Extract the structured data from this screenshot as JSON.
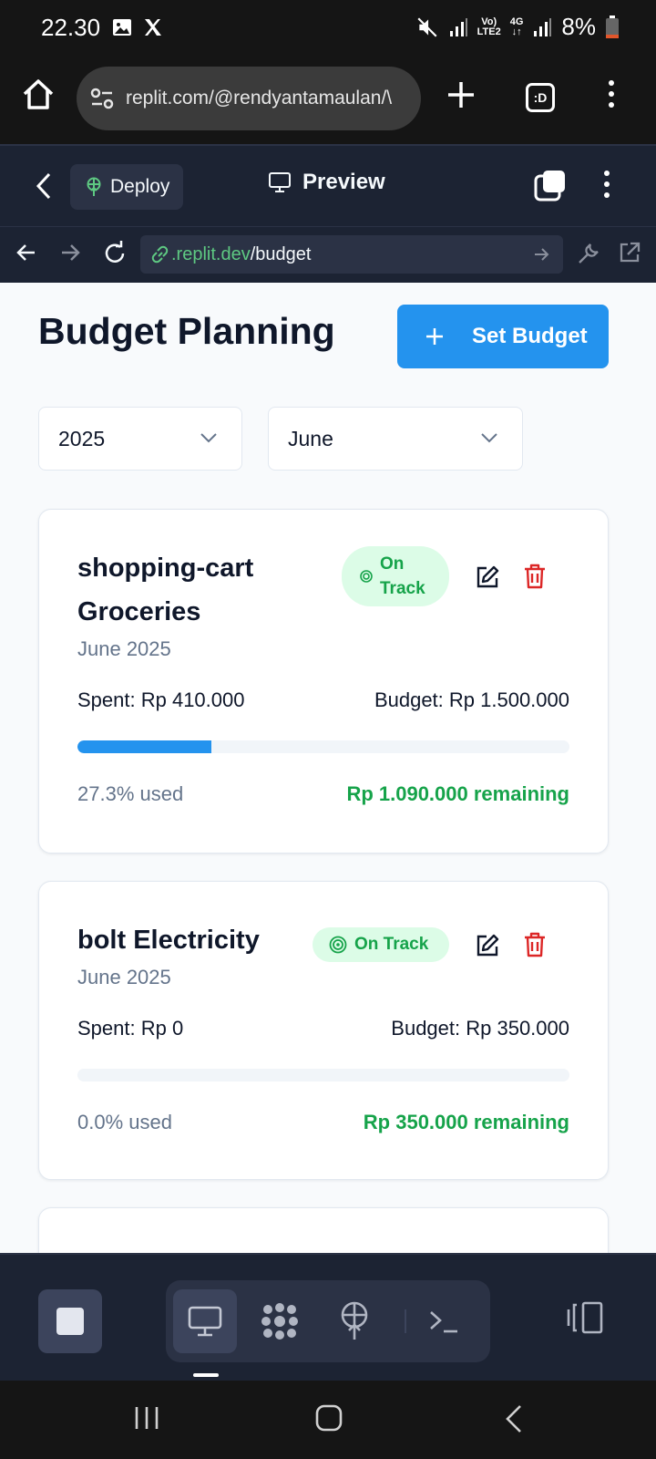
{
  "status_bar": {
    "time": "22.30",
    "network_label_top": "Vo)",
    "network_label_bottom": "LTE2",
    "network_gen_top": "4G",
    "network_gen_bottom": "↓↑",
    "battery": "8%"
  },
  "browser": {
    "url": "replit.com/@rendyantamaulan/\\",
    "tab_count": ":D"
  },
  "replit_bar": {
    "deploy_label": "Deploy",
    "preview_label": "Preview"
  },
  "url_bar": {
    "domain": ".replit.dev",
    "path": "/budget"
  },
  "page": {
    "title": "Budget Planning",
    "set_budget_label": "Set Budget",
    "year_select": "2025",
    "month_select": "June"
  },
  "budgets": [
    {
      "name_line1": "shopping-cart",
      "name_line2": "Groceries",
      "period": "June 2025",
      "status_line1": "On",
      "status_line2": "Track",
      "spent": "Spent: Rp 410.000",
      "budget": "Budget: Rp 1.500.000",
      "used_fraction": 0.273,
      "used_text": "27.3% used",
      "remaining": "Rp 1.090.000 remaining"
    },
    {
      "name": "bolt Electricity",
      "period": "June 2025",
      "status": "On Track",
      "spent": "Spent: Rp 0",
      "budget": "Budget: Rp 350.000",
      "used_fraction": 0.0,
      "used_text": "0.0% used",
      "remaining": "Rp 350.000 remaining"
    }
  ],
  "colors": {
    "accent": "#2493ee",
    "success": "#16a34a",
    "danger": "#dc2626",
    "replit_bg": "#1c2333"
  },
  "icons": {
    "edit": "pencil-square-icon",
    "delete": "trash-icon",
    "status": "target-icon"
  }
}
